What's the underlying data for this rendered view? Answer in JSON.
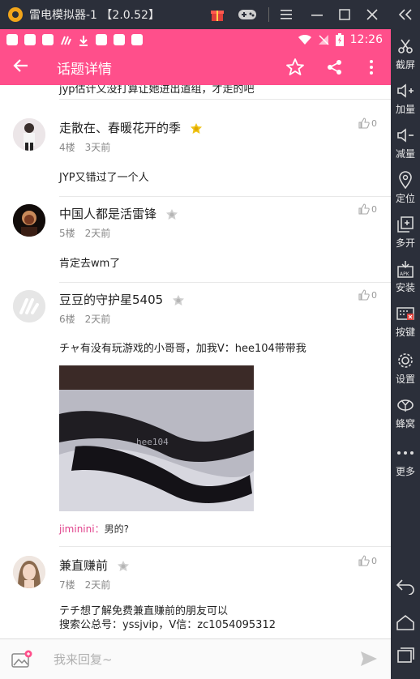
{
  "emulator": {
    "title": "雷电模拟器-1 【2.0.52】",
    "sidebar": [
      {
        "label": "截屏",
        "icon": "scissors-icon"
      },
      {
        "label": "加量",
        "icon": "volume-up-icon"
      },
      {
        "label": "减量",
        "icon": "volume-down-icon"
      },
      {
        "label": "定位",
        "icon": "location-pin-icon"
      },
      {
        "label": "多开",
        "icon": "multi-instance-icon"
      },
      {
        "label": "安装",
        "icon": "apk-install-icon"
      },
      {
        "label": "按键",
        "icon": "keyboard-icon"
      },
      {
        "label": "设置",
        "icon": "gear-icon"
      },
      {
        "label": "蜂窝",
        "icon": "hive-icon"
      },
      {
        "label": "更多",
        "icon": "more-dots-icon"
      }
    ]
  },
  "status_bar": {
    "time": "12:26"
  },
  "app_bar": {
    "title": "话题详情"
  },
  "previous_text": "jyp估计又没打算让她进出道组，才走的吧",
  "comments": [
    {
      "user": "走散在、春暖花开的季",
      "floor": "4楼",
      "time": "3天前",
      "likes": "0",
      "text": "JYP又错过了一个人",
      "badge": "gold"
    },
    {
      "user": "中国人都是活雷锋",
      "floor": "5楼",
      "time": "2天前",
      "likes": "0",
      "text": "肯定去wm了",
      "badge": "grey"
    },
    {
      "user": "豆豆的守护星5405",
      "floor": "6楼",
      "time": "2天前",
      "likes": "0",
      "text": "チャ有没有玩游戏的小哥哥，加我V：hee104带带我",
      "badge": "grey",
      "image_watermark": "hee104",
      "reply_user": "jiminini：",
      "reply_text": "男的?"
    },
    {
      "user": "兼直赚前",
      "floor": "7楼",
      "time": "2天前",
      "likes": "0",
      "text_lines": [
        "テチ想了解免费兼直赚前的朋友可以",
        "搜索公总号：yssjvip，V信：zc1054095312"
      ],
      "badge": "grey"
    }
  ],
  "input": {
    "placeholder": "我来回复~"
  },
  "colors": {
    "brand": "#ff4f8b",
    "emulator_bg": "#2b2f3a",
    "reply_user": "#e0408a"
  }
}
